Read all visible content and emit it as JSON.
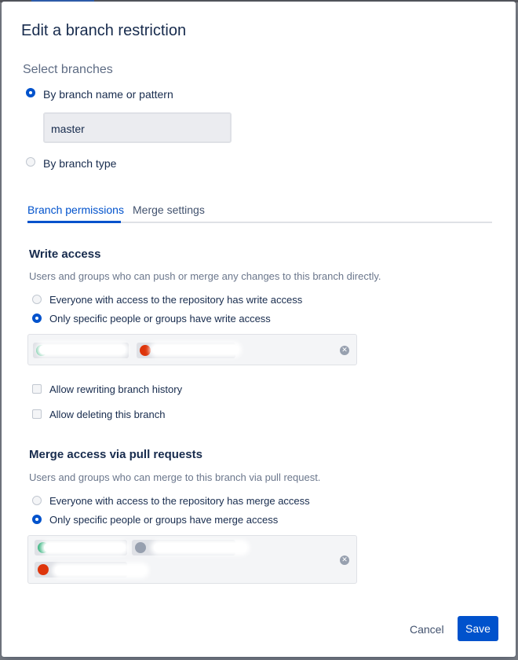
{
  "dialog": {
    "title": "Edit a branch restriction"
  },
  "select_branches": {
    "heading": "Select branches",
    "option_pattern": "By branch name or pattern",
    "pattern_value": "master",
    "option_type": "By branch type",
    "selected": "pattern"
  },
  "tabs": [
    {
      "label": "Branch permissions",
      "active": true
    },
    {
      "label": "Merge settings",
      "active": false
    }
  ],
  "write_access": {
    "heading": "Write access",
    "description": "Users and groups who can push or merge any changes to this branch directly.",
    "option_everyone": "Everyone with access to the repository has write access",
    "option_specific": "Only specific people or groups have write access",
    "selected": "specific",
    "allow_rewrite": "Allow rewriting branch history",
    "allow_delete": "Allow deleting this branch",
    "allow_rewrite_checked": false,
    "allow_delete_checked": false
  },
  "merge_access": {
    "heading": "Merge access via pull requests",
    "description": "Users and groups who can merge to this branch via pull request.",
    "option_everyone": "Everyone with access to the repository has merge access",
    "option_specific": "Only specific people or groups have merge access",
    "selected": "specific"
  },
  "footer": {
    "cancel_label": "Cancel",
    "save_label": "Save"
  },
  "colors": {
    "primary": "#0052cc",
    "text": "#172b4d",
    "muted": "#6b778c"
  },
  "icons": {
    "clear": "clear-icon"
  }
}
